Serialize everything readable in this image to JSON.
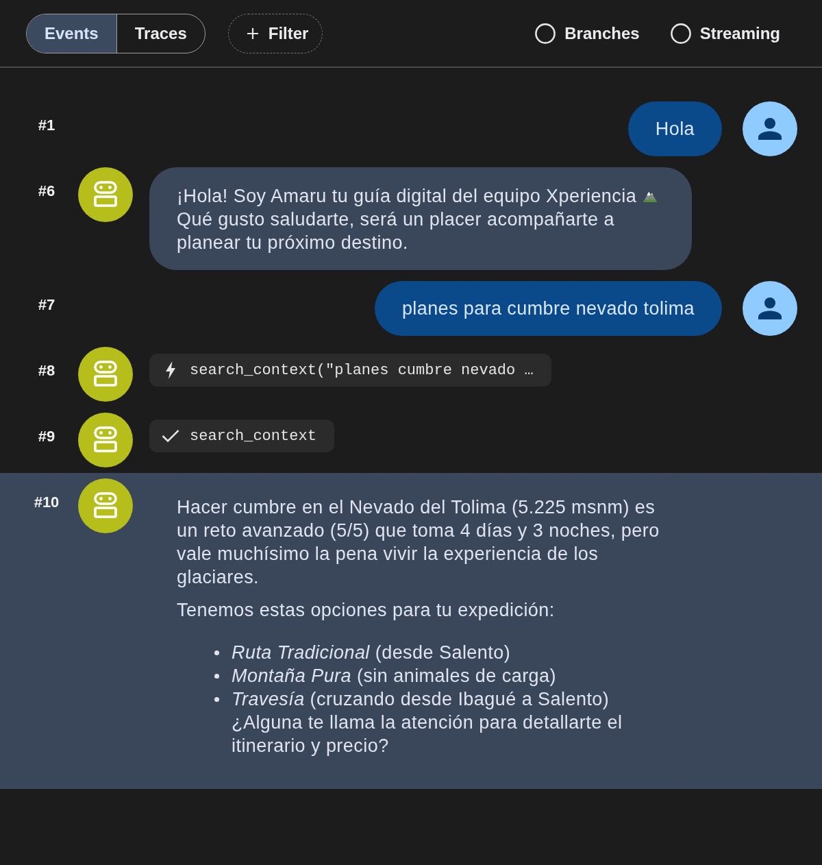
{
  "toolbar": {
    "view_tabs": [
      {
        "label": "Events",
        "selected": true
      },
      {
        "label": "Traces",
        "selected": false
      }
    ],
    "filter_button": {
      "label": "Filter"
    },
    "toggles": [
      {
        "label": "Branches",
        "on": false
      },
      {
        "label": "Streaming",
        "on": false
      }
    ]
  },
  "events": [
    {
      "number": "#1",
      "kind": "user",
      "selected": false,
      "text": "Hola"
    },
    {
      "number": "#6",
      "kind": "assistant",
      "selected": false,
      "blocks": [
        {
          "kind": "text",
          "text": "¡Hola! Soy Amaru tu guía digital del equipo Xperiencia"
        },
        {
          "kind": "emoji"
        },
        {
          "kind": "text",
          "text": "Qué gusto saludarte, será un placer acompañarte a planear tu próximo destino."
        }
      ]
    },
    {
      "number": "#7",
      "kind": "user",
      "selected": false,
      "text": "planes para cumbre nevado tolima"
    },
    {
      "number": "#8",
      "kind": "tool_call",
      "selected": false,
      "text": "search_context(\"planes cumbre nevado …"
    },
    {
      "number": "#9",
      "kind": "tool_result",
      "selected": false,
      "text": "search_context"
    },
    {
      "number": "#10",
      "kind": "assistant",
      "selected": true,
      "blocks": [
        {
          "kind": "paragraph",
          "text": "Hacer cumbre en el Nevado del Tolima (5.225 msnm) es un reto avanzado (5/5) que toma 4 días y 3 noches, pero vale muchísimo la pena vivir la experiencia de los glaciares."
        },
        {
          "kind": "paragraph",
          "text": "Tenemos estas opciones para tu expedición:"
        },
        {
          "kind": "bullets",
          "items": [
            "*Ruta Tradicional* (desde Salento)",
            "*Montaña Pura* (sin animales de carga)",
            "*Travesía* (cruzando desde Ibagué a Salento)\n¿Alguna te llama la atención para detallarte el itinerario y precio?"
          ]
        }
      ]
    }
  ]
}
